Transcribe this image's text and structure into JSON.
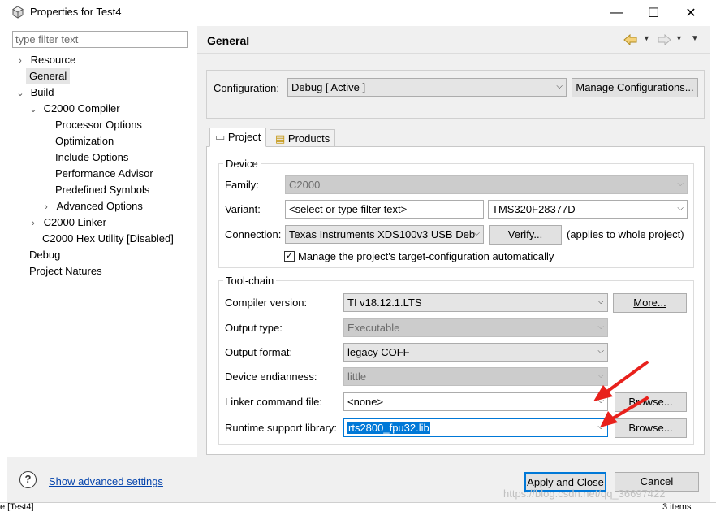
{
  "window": {
    "title": "Properties for Test4",
    "minimize": "—",
    "maximize": "☐",
    "close": "✕"
  },
  "filter": {
    "placeholder": "type filter text"
  },
  "tree": {
    "resource": "Resource",
    "general": "General",
    "build": "Build",
    "c2000_compiler": "C2000 Compiler",
    "processor_options": "Processor Options",
    "optimization": "Optimization",
    "include_options": "Include Options",
    "performance_advisor": "Performance Advisor",
    "predefined_symbols": "Predefined Symbols",
    "advanced_options": "Advanced Options",
    "c2000_linker": "C2000 Linker",
    "c2000_hex_utility": "C2000 Hex Utility  [Disabled]",
    "debug": "Debug",
    "project_natures": "Project Natures"
  },
  "header": {
    "title": "General"
  },
  "configuration": {
    "label": "Configuration:",
    "value": "Debug  [ Active ]",
    "manage_button": "Manage Configurations..."
  },
  "tabs": {
    "project": "Project",
    "products": "Products"
  },
  "device": {
    "legend": "Device",
    "family_label": "Family:",
    "family_value": "C2000",
    "variant_label": "Variant:",
    "variant_filter": "<select or type filter text>",
    "variant_value": "TMS320F28377D",
    "connection_label": "Connection:",
    "connection_value": "Texas Instruments XDS100v3 USB Deb",
    "verify_button": "Verify...",
    "applies_text": "(applies to whole project)",
    "manage_checkbox_label": "Manage the project's target-configuration automatically"
  },
  "toolchain": {
    "legend": "Tool-chain",
    "compiler_version_label": "Compiler version:",
    "compiler_version_value": "TI v18.12.1.LTS",
    "more_button": "More...",
    "output_type_label": "Output type:",
    "output_type_value": "Executable",
    "output_format_label": "Output format:",
    "output_format_value": "legacy COFF",
    "endianness_label": "Device endianness:",
    "endianness_value": "little",
    "linker_cmd_label": "Linker command file:",
    "linker_cmd_value": "<none>",
    "browse_button": "Browse...",
    "runtime_lib_label": "Runtime support library:",
    "runtime_lib_value": "rts2800_fpu32.lib"
  },
  "bottom": {
    "help": "?",
    "show_advanced": "Show advanced settings",
    "apply_close": "Apply and Close",
    "cancel": "Cancel"
  },
  "watermark": "https://blog.csdn.net/qq_36697422",
  "status": {
    "left": "e [Test4]",
    "right": "3 items"
  },
  "colors": {
    "selection": "#0078d7",
    "link": "#0645ad",
    "arrow_red": "#e8211c"
  }
}
